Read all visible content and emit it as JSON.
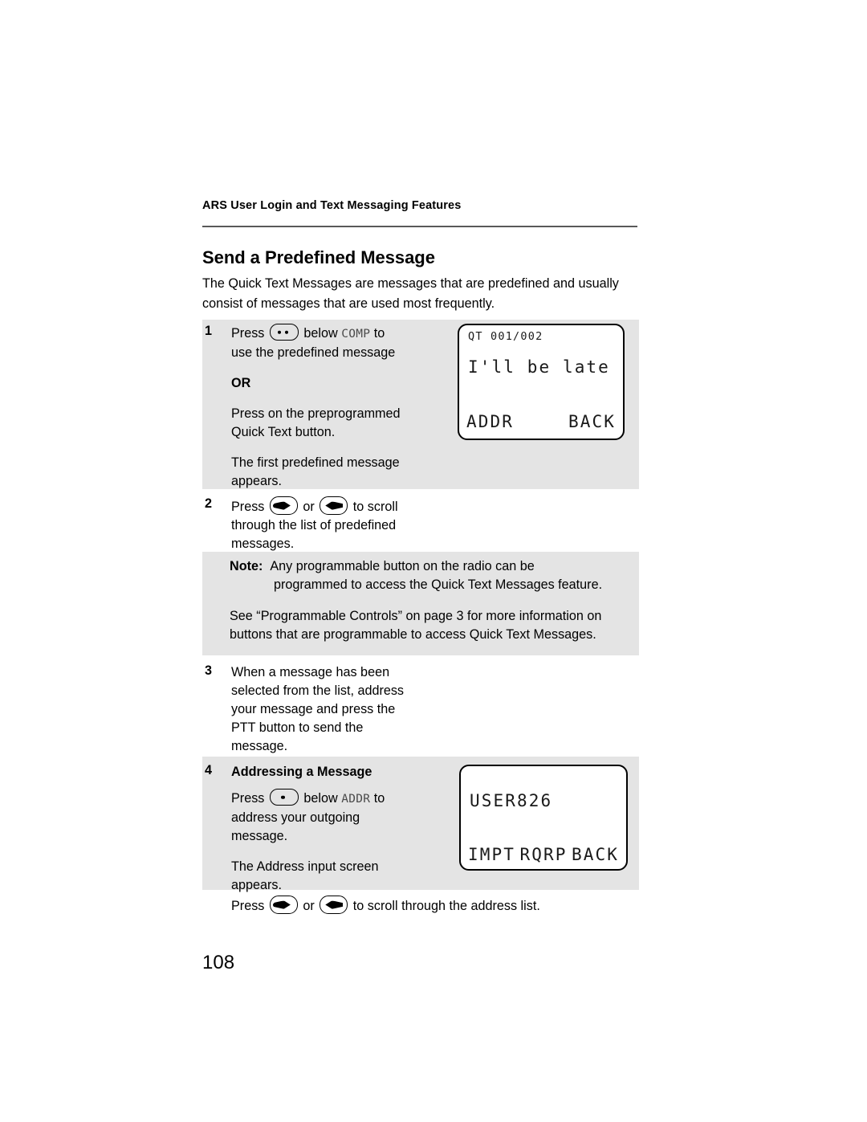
{
  "header": {
    "running_head": "ARS User Login and Text Messaging Features"
  },
  "title": "Send a Predefined Message",
  "intro": "The Quick Text Messages are messages that are predefined and usually consist of messages that are used most frequently.",
  "steps": [
    {
      "number": "1",
      "press_label": "Press",
      "below_label": "below",
      "soft_key": "COMP",
      "to_label": "to",
      "line2": "use the predefined message",
      "or": "OR",
      "alt_line1": "Press on the preprogrammed",
      "alt_line2": "Quick Text button.",
      "result_line1": "The first predefined message",
      "result_line2": "appears."
    },
    {
      "number": "2",
      "press_label": "Press",
      "or_label": "or",
      "tail_label": "to scroll",
      "line2": "through the list of predefined",
      "line3": "messages."
    },
    {
      "number": "3",
      "line1": "When a message has been",
      "line2": "selected from the list, address",
      "line3": "your message and press the",
      "line4": "PTT button to send the",
      "line5": "message."
    },
    {
      "number": "4",
      "heading": "Addressing a Message",
      "press_label": "Press",
      "below_label": "below",
      "soft_key": "ADDR",
      "to_label": "to",
      "line2": "address your outgoing",
      "line3": "message.",
      "result_line1": "The Address input screen",
      "result_line2": "appears."
    }
  ],
  "note": {
    "label": "Note:",
    "line1": "Any programmable button on the radio can be",
    "line2": "programmed to access the Quick Text Messages feature.",
    "paragraph": "See “Programmable Controls” on page 3 for more information on buttons that are programmable to access Quick Text Messages."
  },
  "lcd_screens": [
    {
      "id": "quick-text-screen",
      "top_line": "QT 001/002",
      "message": "I'll be late",
      "soft_keys": [
        "ADDR",
        "BACK"
      ]
    },
    {
      "id": "address-screen",
      "top_line": "",
      "message": "USER826",
      "soft_keys": [
        "IMPT",
        "RQRP",
        "BACK"
      ]
    }
  ],
  "closing": {
    "press_label": "Press",
    "or_label": "or",
    "tail_label": "to scroll through the address list."
  },
  "page_number": "108",
  "colors": {
    "band": "#e4e4e4",
    "rule": "#595959",
    "text": "#000000"
  }
}
